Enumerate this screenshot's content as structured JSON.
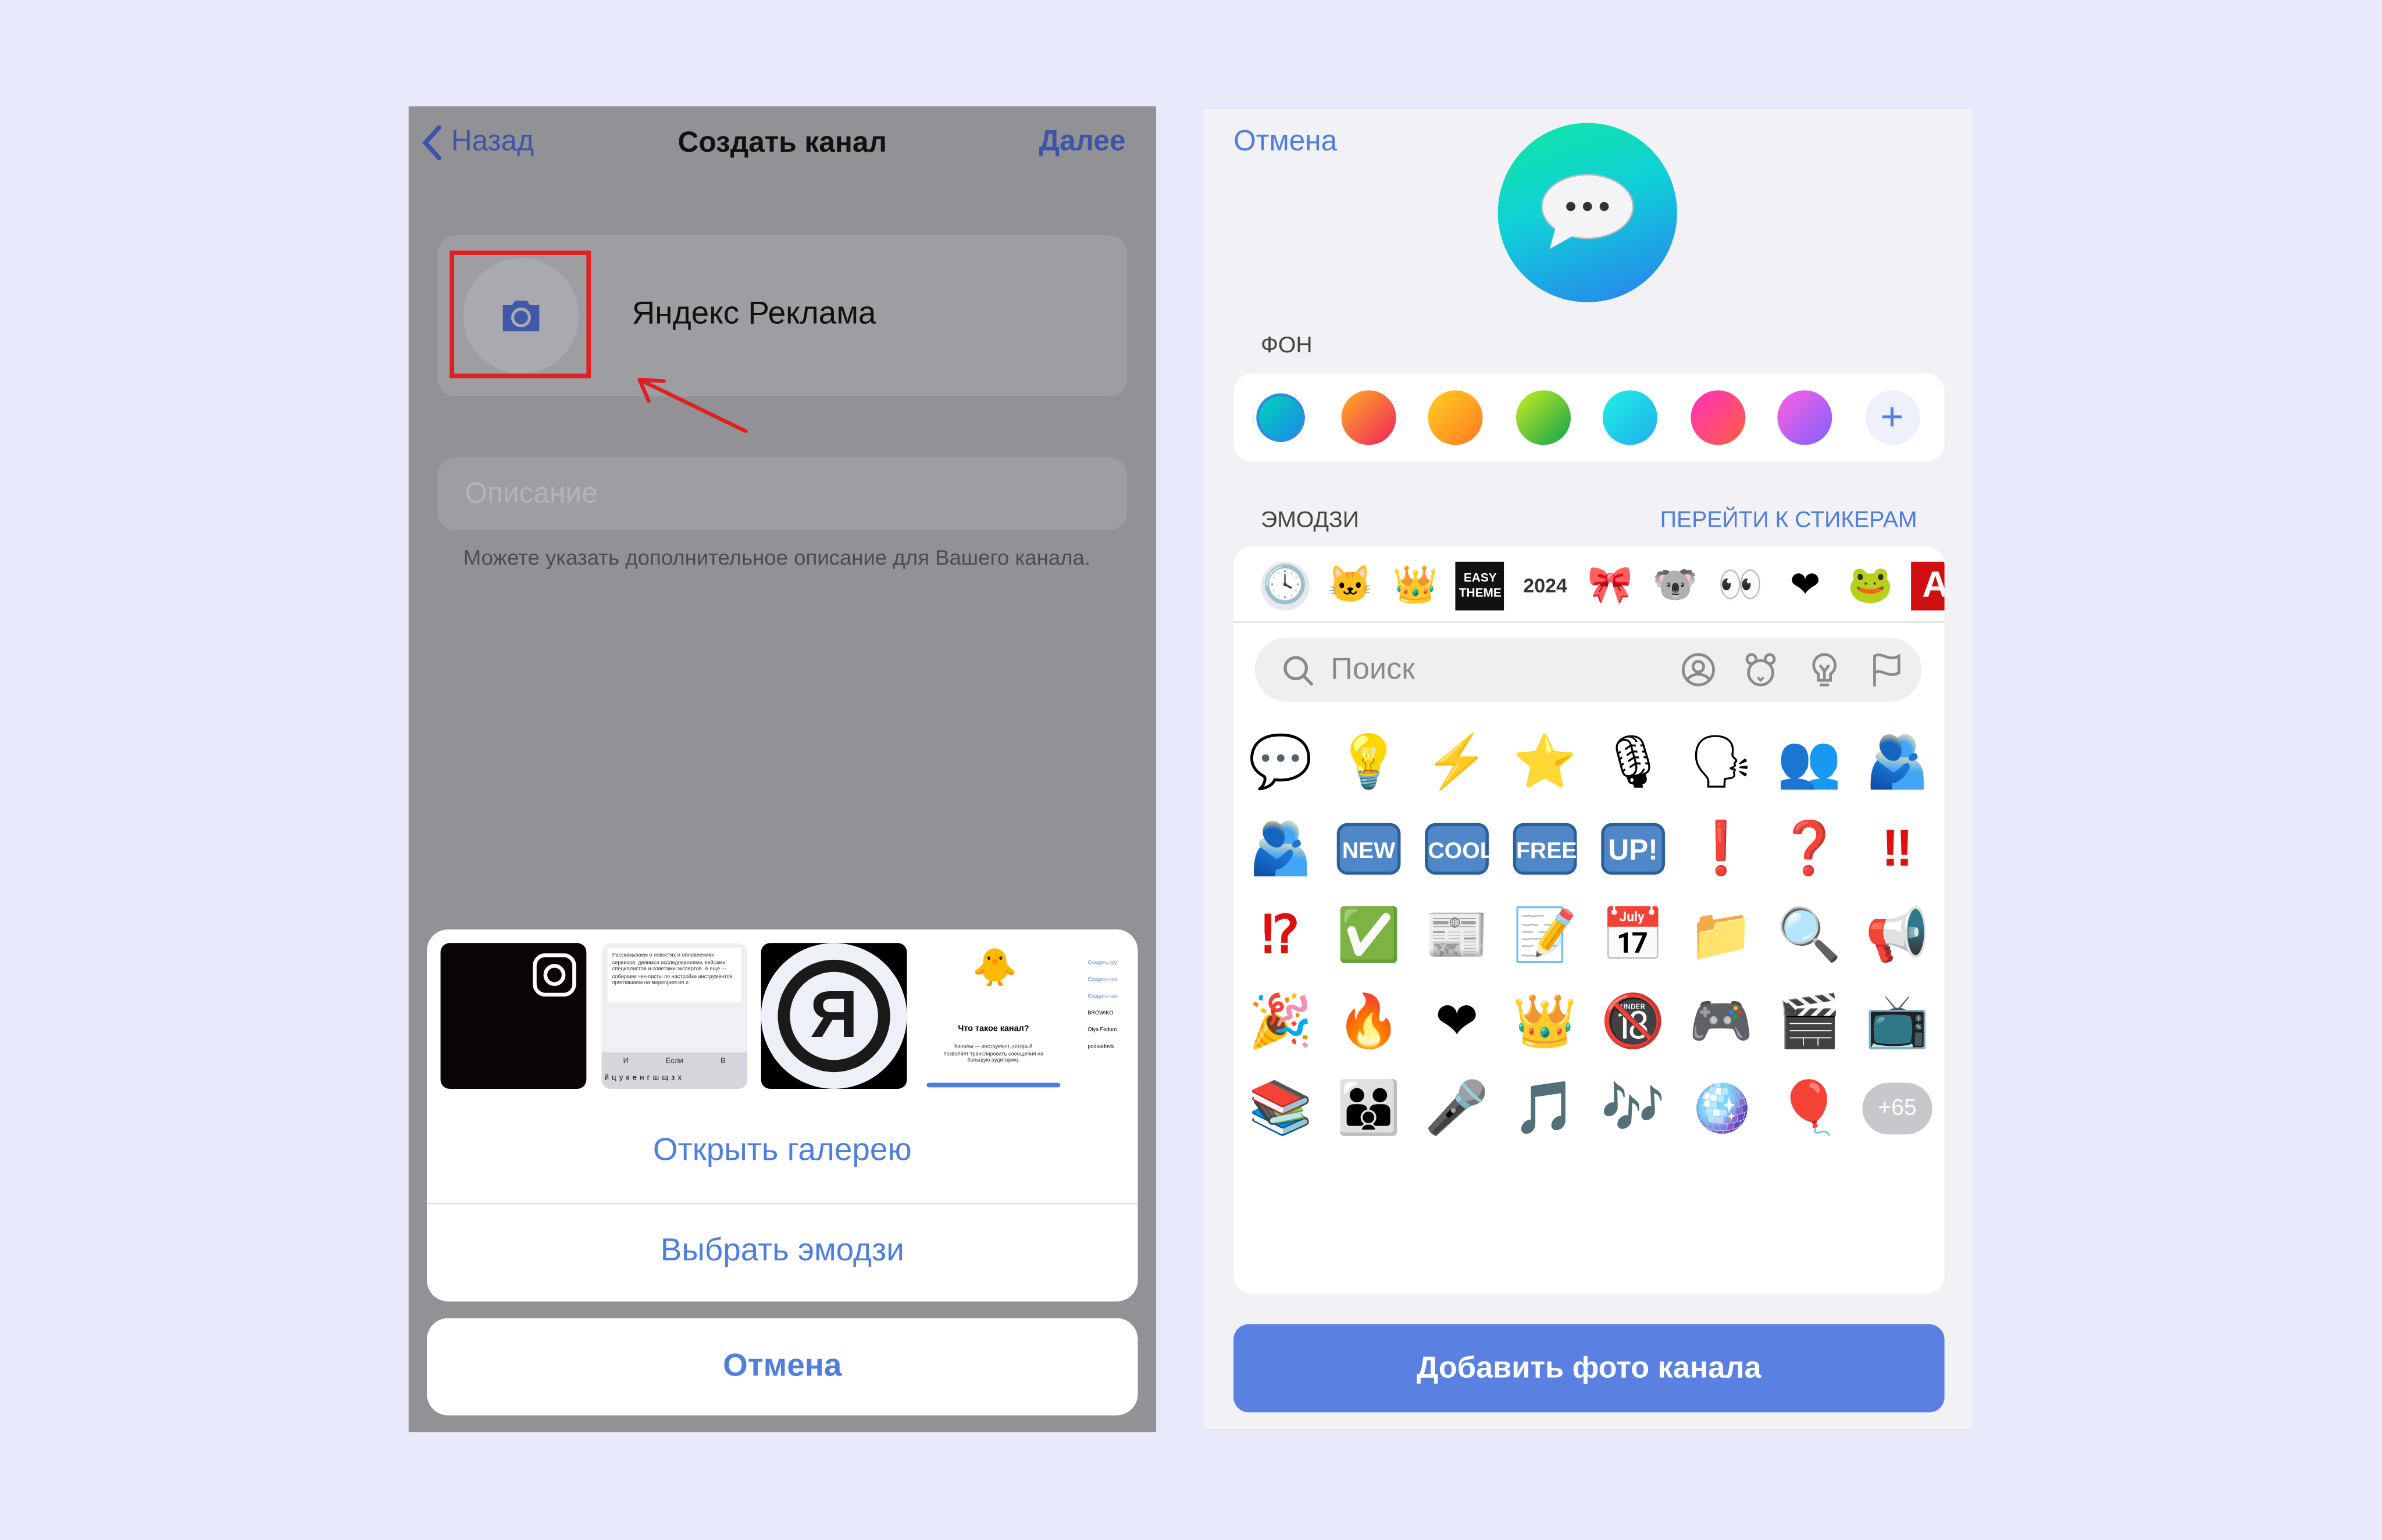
{
  "left": {
    "nav": {
      "back": "Назад",
      "title": "Создать канал",
      "next": "Далее"
    },
    "channel_name": "Яндекс Реклама",
    "description_placeholder": "Описание",
    "description_hint": "Можете указать дополнительное описание для Вашего канала.",
    "gallery_thumbs": [
      {
        "kind": "instagram-logo"
      },
      {
        "kind": "screenshot",
        "text": "Рассказываем о новостях и обновлениях сервисов, делимся исследованиями, кейсами специалистов и советами экспертов. А ещё — собираем чек-листы по настройке инструментов, приглашаем на мероприятия и",
        "suggestions": [
          "И",
          "Если",
          "В"
        ],
        "keys": "йцукенгшщзх"
      },
      {
        "kind": "yandex-logo",
        "letter": "Я"
      },
      {
        "kind": "screenshot",
        "title": "Что такое канал?",
        "text": "Каналы — инструмент, который позволяет транслировать сообщения на большую аудиторию."
      },
      {
        "kind": "screenshot",
        "items": [
          "Создать гру",
          "Создать кон",
          "Создать кан",
          "BROWIKO",
          "Olya Fedoro",
          "podsadova"
        ]
      }
    ],
    "sheet": {
      "open_gallery": "Открыть галерею",
      "choose_emoji": "Выбрать эмодзи",
      "cancel": "Отмена"
    },
    "highlight_color": "#e02020"
  },
  "right": {
    "cancel": "Отмена",
    "background_label": "ФОН",
    "background_swatches": [
      {
        "from": "#00e0b0",
        "to": "#1e7ef0",
        "selected": true
      },
      {
        "from": "#ffb020",
        "to": "#f02060"
      },
      {
        "from": "#ffd020",
        "to": "#ff7a20"
      },
      {
        "from": "#c8f020",
        "to": "#10a050"
      },
      {
        "from": "#20f0e0",
        "to": "#20b0f0"
      },
      {
        "from": "#ff30c0",
        "to": "#ff6040"
      },
      {
        "from": "#ff60e0",
        "to": "#8060ff"
      }
    ],
    "add_swatch": "+",
    "emoji_label": "ЭМОДЗИ",
    "stickers_link": "ПЕРЕЙТИ К СТИКЕРАМ",
    "sticker_packs": [
      "🕓",
      "🐱",
      "👑",
      "EASY THEME",
      "2024",
      "🎀",
      "🐨",
      "👀",
      "❤",
      "🐸",
      "A"
    ],
    "search_placeholder": "Поиск",
    "search_category_icons": [
      "smiley-icon",
      "animal-icon",
      "lightbulb-icon",
      "flag-icon"
    ],
    "emoji_rows": [
      [
        "💬",
        "💡",
        "⚡",
        "⭐",
        "🎙",
        "🗣",
        "👥",
        "🫂"
      ],
      [
        "🫂",
        "NEW",
        "COOL",
        "FREE",
        "UP!",
        "❗",
        "❓",
        "‼"
      ],
      [
        "⁉",
        "✅",
        "📰",
        "📝",
        "📅",
        "📁",
        "🔍",
        "📢"
      ],
      [
        "🎉",
        "🔥",
        "❤",
        "👑",
        "🔞",
        "🎮",
        "🎬",
        "📺"
      ],
      [
        "📚",
        "👪",
        "🎤",
        "🎵",
        "🎶",
        "🪩",
        "🎈",
        "+65"
      ]
    ],
    "add_button": "Добавить фото канала",
    "accent": "#5a80e2"
  }
}
